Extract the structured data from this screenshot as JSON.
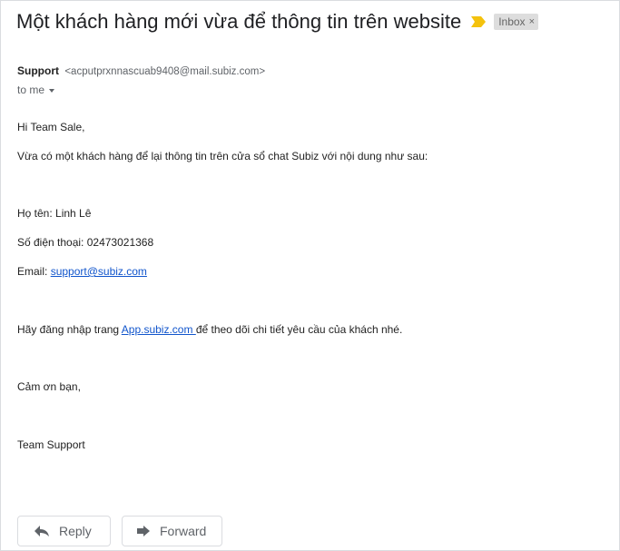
{
  "email": {
    "subject": "Một khách hàng mới vừa để thông tin trên website",
    "label": "Inbox",
    "label_close": "×",
    "sender_name": "Support",
    "sender_email": "<acputprxnnascuab9408@mail.subiz.com>",
    "recipient": "to me",
    "body": {
      "greeting": "Hi Team Sale,",
      "intro": "Vừa có một khách hàng để lại thông tin trên cửa sổ chat Subiz với nội dung như sau:",
      "name_line": "Họ tên: Linh Lê",
      "phone_line": "Số điện thoại: 02473021368",
      "email_prefix": "Email: ",
      "email_link": "support@subiz.com",
      "login_prefix": "Hãy đăng nhập trang ",
      "login_link": "App.subiz.com ",
      "login_suffix": "để theo dõi chi tiết yêu cầu của khách nhé.",
      "thanks": "Cảm ơn bạn,",
      "signature": "Team Support"
    }
  },
  "actions": {
    "reply_label": "Reply",
    "forward_label": "Forward"
  },
  "icons": {
    "importance": "importance-marker-icon",
    "reply": "reply-arrow-icon",
    "forward": "forward-arrow-icon",
    "recipient_details": "caret-down-icon"
  },
  "colors": {
    "importance": "#f4c20d",
    "link": "#1155cc",
    "label_bg": "#dddddd"
  }
}
